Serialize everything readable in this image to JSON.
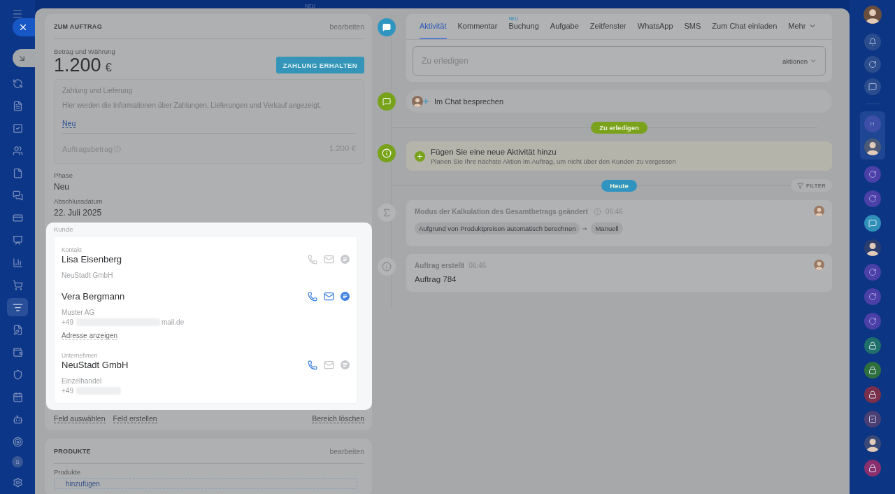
{
  "top_bar": {
    "badge": "NEU"
  },
  "left_nav": {
    "avatar_letter": "S",
    "items": [
      {
        "kind": "flow",
        "selected": false
      },
      {
        "kind": "doc",
        "selected": false
      },
      {
        "kind": "check",
        "selected": false
      },
      {
        "kind": "people",
        "selected": false
      },
      {
        "kind": "file",
        "selected": false
      },
      {
        "kind": "chats",
        "selected": false
      },
      {
        "kind": "card",
        "selected": false
      },
      {
        "kind": "board",
        "selected": false
      },
      {
        "kind": "chart",
        "selected": false
      },
      {
        "kind": "cart",
        "selected": false
      },
      {
        "kind": "funnel",
        "selected": true
      },
      {
        "kind": "edit",
        "selected": false
      },
      {
        "kind": "wallet",
        "selected": false
      },
      {
        "kind": "shield",
        "selected": false
      },
      {
        "kind": "calendar",
        "selected": false
      },
      {
        "kind": "bot",
        "selected": false
      },
      {
        "kind": "target",
        "selected": false
      }
    ]
  },
  "order_card": {
    "title": "ZUM AUFTRAG",
    "edit": "bearbeiten",
    "amount_label": "Betrag und Währung",
    "amount": "1.200",
    "currency": "€",
    "pay_button": "ZAHLUNG ERHALTEN",
    "payment": {
      "title": "Zahlung und Lieferung",
      "text": "Hier werden die Informationen über Zahlungen, Lieferungen und Verkauf angezeigt.",
      "link": "Neu",
      "total_label": "Auftragsbetrag",
      "total": "1.200 €"
    },
    "fields": [
      {
        "label": "Phase",
        "value": "Neu"
      },
      {
        "label": "Abschlussdatum",
        "value": "22. Juli 2025"
      }
    ],
    "customer": {
      "label": "Kunde",
      "contacts": [
        {
          "label": "Kontakt",
          "name": "Lisa Eisenberg",
          "lines": [
            {
              "kind": "company",
              "text": "NeuStadt GmbH"
            }
          ],
          "actions": [
            {
              "kind": "phone",
              "enabled": false
            },
            {
              "kind": "mail",
              "enabled": false
            },
            {
              "kind": "chat",
              "enabled": false
            }
          ]
        },
        {
          "name": "Vera Bergmann",
          "lines": [
            {
              "kind": "company",
              "text": "Muster AG"
            },
            {
              "kind": "redacted",
              "prefix": "+49",
              "suffix": "mail.de"
            },
            {
              "kind": "link",
              "text": "Adresse anzeigen"
            }
          ],
          "actions": [
            {
              "kind": "phone",
              "enabled": true
            },
            {
              "kind": "mail",
              "enabled": true
            },
            {
              "kind": "chat",
              "enabled": true
            }
          ]
        },
        {
          "label": "Unternehmen",
          "name": "NeuStadt GmbH",
          "lines": [
            {
              "kind": "company",
              "text": "Einzelhandel"
            },
            {
              "kind": "redacted",
              "prefix": "+49"
            }
          ],
          "actions": [
            {
              "kind": "phone",
              "enabled": true
            },
            {
              "kind": "mail",
              "enabled": false
            },
            {
              "kind": "chat",
              "enabled": false
            }
          ]
        }
      ]
    },
    "footer_links": [
      "Feld auswählen",
      "Feld erstellen"
    ],
    "footer_right": "Bereich löschen"
  },
  "products_card": {
    "title": "PRODUKTE",
    "edit": "bearbeiten",
    "label": "Produkte",
    "add": "hinzufügen"
  },
  "timeline": {
    "tabs": [
      {
        "label": "Aktivität",
        "selected": true
      },
      {
        "label": "Kommentar",
        "selected": false
      },
      {
        "label": "Buchung",
        "selected": false,
        "badge": "NEU"
      },
      {
        "label": "Aufgabe",
        "selected": false
      },
      {
        "label": "Zeitfenster",
        "selected": false
      },
      {
        "label": "WhatsApp",
        "selected": false
      },
      {
        "label": "SMS",
        "selected": false
      },
      {
        "label": "Zum Chat einladen",
        "selected": false
      },
      {
        "label": "Mehr",
        "selected": false
      }
    ],
    "input_placeholder": "Zu erledigen",
    "input_action": "aktionen",
    "chat_item": "Im Chat besprechen",
    "todo_divider": "Zu erledigen",
    "add_activity": {
      "title": "Fügen Sie eine neue Aktivität hinzu",
      "text": "Planen Sie Ihre nächste Aktion im Auftrag, um nicht über den Kunden zu vergessen"
    },
    "today_divider": "Heute",
    "filter": "FILTER",
    "events": [
      {
        "kind": "sum",
        "title": "Modus der Kalkulation des Gesamtbetrags geändert",
        "time": "06:46",
        "from": "Aufgrund von Produktpreisen automatisch berechnen",
        "to": "Manuell"
      },
      {
        "kind": "info",
        "title": "Auftrag erstellt",
        "time": "06:46",
        "body": "Auftrag 784"
      }
    ]
  },
  "right_nav": {
    "group_letter": "H",
    "items": [
      {
        "kind": "ring",
        "color": "#4b3fa8"
      },
      {
        "kind": "ring",
        "color": "#4b3fa8"
      },
      {
        "kind": "chat",
        "color": "#2f8fb8"
      },
      {
        "kind": "avatar",
        "color": "#2a3f6e"
      },
      {
        "kind": "ring",
        "color": "#4b3fa8"
      },
      {
        "kind": "ring",
        "color": "#4b3fa8"
      },
      {
        "kind": "ring",
        "color": "#4b3fa8"
      },
      {
        "kind": "lock",
        "color": "#1f6f6a"
      },
      {
        "kind": "lock",
        "color": "#2e6f3e"
      },
      {
        "kind": "lock",
        "color": "#7a2f4a"
      },
      {
        "kind": "check",
        "color": "#4a3f72"
      },
      {
        "kind": "avatar",
        "color": "#3a4a78"
      },
      {
        "kind": "lock",
        "color": "#8a2f6e"
      }
    ]
  }
}
